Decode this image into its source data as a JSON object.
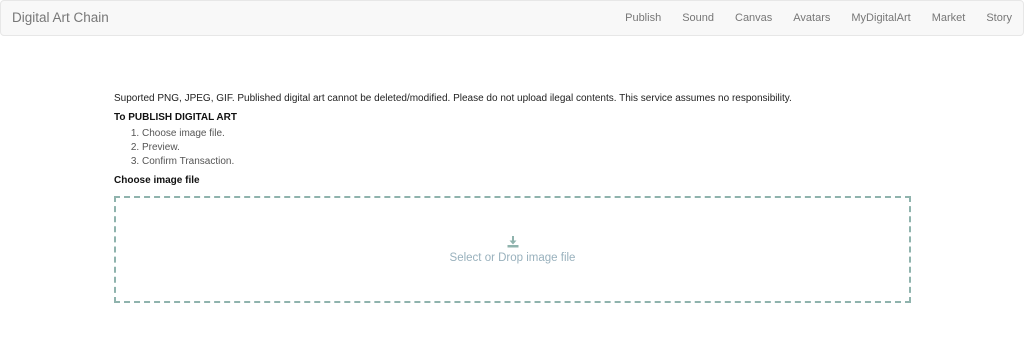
{
  "navbar": {
    "brand": "Digital Art Chain",
    "items": [
      {
        "label": "Publish"
      },
      {
        "label": "Sound"
      },
      {
        "label": "Canvas"
      },
      {
        "label": "Avatars"
      },
      {
        "label": "MyDigitalArt"
      },
      {
        "label": "Market"
      },
      {
        "label": "Story"
      }
    ]
  },
  "main": {
    "notice": "Suported PNG, JPEG, GIF. Published digital art cannot be deleted/modified. Please do not upload ilegal contents. This service assumes no responsibility.",
    "publish_heading": "To PUBLISH DIGITAL ART",
    "steps": [
      "Choose image file.",
      "Preview.",
      "Confirm Transaction."
    ],
    "choose_label": "Choose image file",
    "dropzone": {
      "icon": "download-icon",
      "text": "Select or Drop image file",
      "accent_color": "#8fb3ad"
    }
  }
}
